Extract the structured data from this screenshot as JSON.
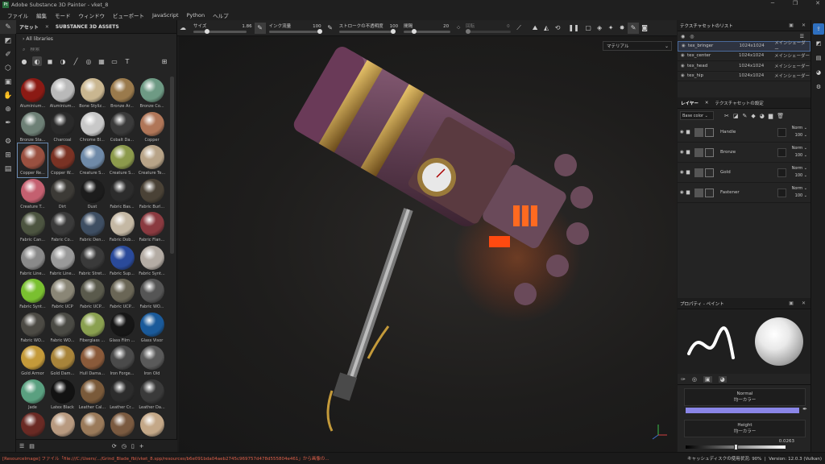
{
  "window": {
    "title": "Adobe Substance 3D Painter - vket_8"
  },
  "menu": [
    "ファイル",
    "編集",
    "モード",
    "ウィンドウ",
    "ビューポート",
    "JavaScript",
    "Python",
    "ヘルプ"
  ],
  "assets": {
    "tabs": [
      "アセット",
      "SUBSTANCE 3D ASSETS"
    ],
    "library": "All libraries",
    "search_placeholder": "検索",
    "items": [
      {
        "label": "Aluminium...",
        "color": "#8b1a14"
      },
      {
        "label": "Aluminium...",
        "color": "#b9b9b9"
      },
      {
        "label": "Bone Styliz...",
        "color": "#c9b690"
      },
      {
        "label": "Bronze Ar...",
        "color": "#9a7a4c"
      },
      {
        "label": "Bronze Co...",
        "color": "#6e9a84"
      },
      {
        "label": "Bronze Sta...",
        "color": "#6e8076"
      },
      {
        "label": "Charcoal",
        "color": "#2a2a2a"
      },
      {
        "label": "Chrome Bl...",
        "color": "#c8c8c8"
      },
      {
        "label": "Cobalt Da...",
        "color": "#3a3a3a"
      },
      {
        "label": "Copper",
        "color": "#b07658"
      },
      {
        "label": "Copper Re...",
        "color": "#9a5040"
      },
      {
        "label": "Copper W...",
        "color": "#7a3224"
      },
      {
        "label": "Creature S...",
        "color": "#6f8aa8"
      },
      {
        "label": "Creature S...",
        "color": "#8c9a4c"
      },
      {
        "label": "Creature Te...",
        "color": "#b8a488"
      },
      {
        "label": "Creature T...",
        "color": "#c46070"
      },
      {
        "label": "Dirt",
        "color": "#3c3a36"
      },
      {
        "label": "Dust",
        "color": "#1c1c1c"
      },
      {
        "label": "Fabric Bas...",
        "color": "#2c2c2c"
      },
      {
        "label": "Fabric Burl...",
        "color": "#4a4236"
      },
      {
        "label": "Fabric Can...",
        "color": "#4c5440"
      },
      {
        "label": "Fabric Co...",
        "color": "#3a3a3a"
      },
      {
        "label": "Fabric Den...",
        "color": "#3e4e62"
      },
      {
        "label": "Fabric Dob...",
        "color": "#c4b8a4"
      },
      {
        "label": "Fabric Flan...",
        "color": "#8a3a40"
      },
      {
        "label": "Fabric Line...",
        "color": "#8a8a8a"
      },
      {
        "label": "Fabric Line...",
        "color": "#9a9a9a"
      },
      {
        "label": "Fabric Stret...",
        "color": "#3a3a3a"
      },
      {
        "label": "Fabric Sup...",
        "color": "#2a4a9a"
      },
      {
        "label": "Fabric Synt...",
        "color": "#b4aca4"
      },
      {
        "label": "Fabric Synt...",
        "color": "#7ac030"
      },
      {
        "label": "Fabric UCP",
        "color": "#8a8676"
      },
      {
        "label": "Fabric UCP...",
        "color": "#5a5a4c"
      },
      {
        "label": "Fabric UCP...",
        "color": "#6a6656"
      },
      {
        "label": "Fabric WO...",
        "color": "#555555"
      },
      {
        "label": "Fabric WO...",
        "color": "#4c4a44"
      },
      {
        "label": "Fabric WO...",
        "color": "#4a4a44"
      },
      {
        "label": "Fiberglass ...",
        "color": "#8aa050"
      },
      {
        "label": "Glass Film ...",
        "color": "#161616"
      },
      {
        "label": "Glass Visor",
        "color": "#1a5a9a"
      },
      {
        "label": "Gold Armor",
        "color": "#c49a3a"
      },
      {
        "label": "Gold Dam...",
        "color": "#a8843a"
      },
      {
        "label": "Hull Dama...",
        "color": "#8a5a3a"
      },
      {
        "label": "Iron Forge...",
        "color": "#4a4a4a"
      },
      {
        "label": "Iron Old",
        "color": "#5a5a5a"
      },
      {
        "label": "Jade",
        "color": "#5aa080"
      },
      {
        "label": "Latex Black",
        "color": "#121212"
      },
      {
        "label": "Leather Cal...",
        "color": "#7a5a3a"
      },
      {
        "label": "Leather Cr...",
        "color": "#2c2c2c"
      },
      {
        "label": "Leather Da...",
        "color": "#3a3a3a"
      },
      {
        "label": "",
        "color": "#6a2a24"
      },
      {
        "label": "",
        "color": "#b89a80"
      },
      {
        "label": "",
        "color": "#9a7a5a"
      },
      {
        "label": "",
        "color": "#7a5a40"
      },
      {
        "label": "",
        "color": "#c4a888"
      }
    ]
  },
  "toolbar": {
    "size_label": "サイズ",
    "size_value": "1.86",
    "flow_label": "インク流量",
    "flow_value": "100",
    "opacity_label": "ストロークの不透明度",
    "opacity_value": "100",
    "spacing_label": "間隔",
    "spacing_value": "20",
    "jitter_label": "回転",
    "jitter_value": "0"
  },
  "viewport": {
    "material_select": "マテリアル"
  },
  "texture_sets": {
    "title": "テクスチャセットのリスト",
    "rows": [
      {
        "name": "tex_bringer",
        "res": "1024x1024",
        "shader": "メインシェーダー",
        "selected": true
      },
      {
        "name": "tex_center",
        "res": "1024x1024",
        "shader": "メインシェーダー",
        "selected": false
      },
      {
        "name": "tex_head",
        "res": "1024x1024",
        "shader": "メインシェーダー",
        "selected": false
      },
      {
        "name": "tex_hip",
        "res": "1024x1024",
        "shader": "メインシェーダー",
        "selected": false
      }
    ]
  },
  "layers": {
    "tabs": [
      "レイヤー",
      "テクスチャセットの設定"
    ],
    "channel": "Base color",
    "rows": [
      {
        "name": "Handle",
        "blend": "Norm",
        "opacity": "100"
      },
      {
        "name": "Bronze",
        "blend": "Norm",
        "opacity": "100"
      },
      {
        "name": "Gold",
        "blend": "Norm",
        "opacity": "100"
      },
      {
        "name": "Fastener",
        "blend": "Norm",
        "opacity": "100"
      }
    ]
  },
  "properties": {
    "title": "プロパティ - ペイント",
    "normal_label": "Normal",
    "normal_sub": "均一カラー",
    "normal_color": "#8a86e8",
    "height_label": "Height",
    "height_sub": "均一カラー",
    "height_value": "0.0263"
  },
  "status": {
    "error": "[ResourceImage] ファイル「file:///C:/Users/.../Grind_Blade_fbl/vket_8.spp/resources/b6e091bda04aeb2745c969757d478d555804e461」から画像の...",
    "disk_label": "キャッシュディスクの使用状況:",
    "disk_value": "90%",
    "version": "Version: 12.0.3 (Vulkan)"
  },
  "theme": {
    "accent": "#2e6fbf",
    "error": "#e0604a"
  }
}
